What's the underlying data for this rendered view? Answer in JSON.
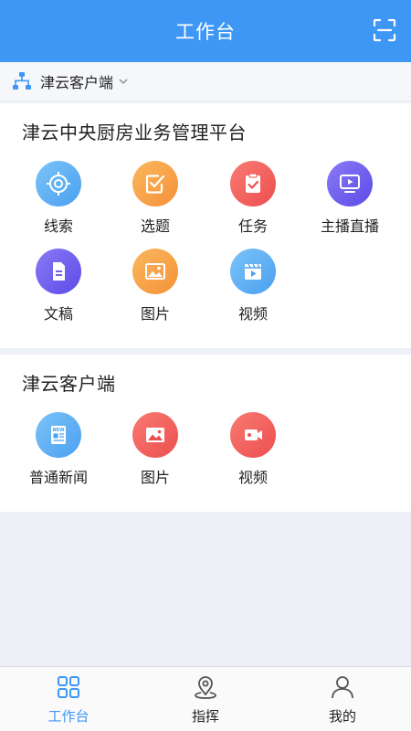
{
  "header": {
    "title": "工作台"
  },
  "org": {
    "name": "津云客户端"
  },
  "section1": {
    "title": "津云中央厨房业务管理平台",
    "items": [
      {
        "label": "线索"
      },
      {
        "label": "选题"
      },
      {
        "label": "任务"
      },
      {
        "label": "主播直播"
      },
      {
        "label": "文稿"
      },
      {
        "label": "图片"
      },
      {
        "label": "视频"
      }
    ]
  },
  "section2": {
    "title": "津云客户端",
    "items": [
      {
        "label": "普通新闻"
      },
      {
        "label": "图片"
      },
      {
        "label": "视频"
      }
    ]
  },
  "tabbar": {
    "items": [
      {
        "label": "工作台"
      },
      {
        "label": "指挥"
      },
      {
        "label": "我的"
      }
    ]
  },
  "colors": {
    "primary": "#3e97f4",
    "blue_icon": "#5aaaf2",
    "orange_icon": "#f7a348",
    "red_icon": "#f05a5a",
    "purple_icon": "#6d5cf0"
  }
}
